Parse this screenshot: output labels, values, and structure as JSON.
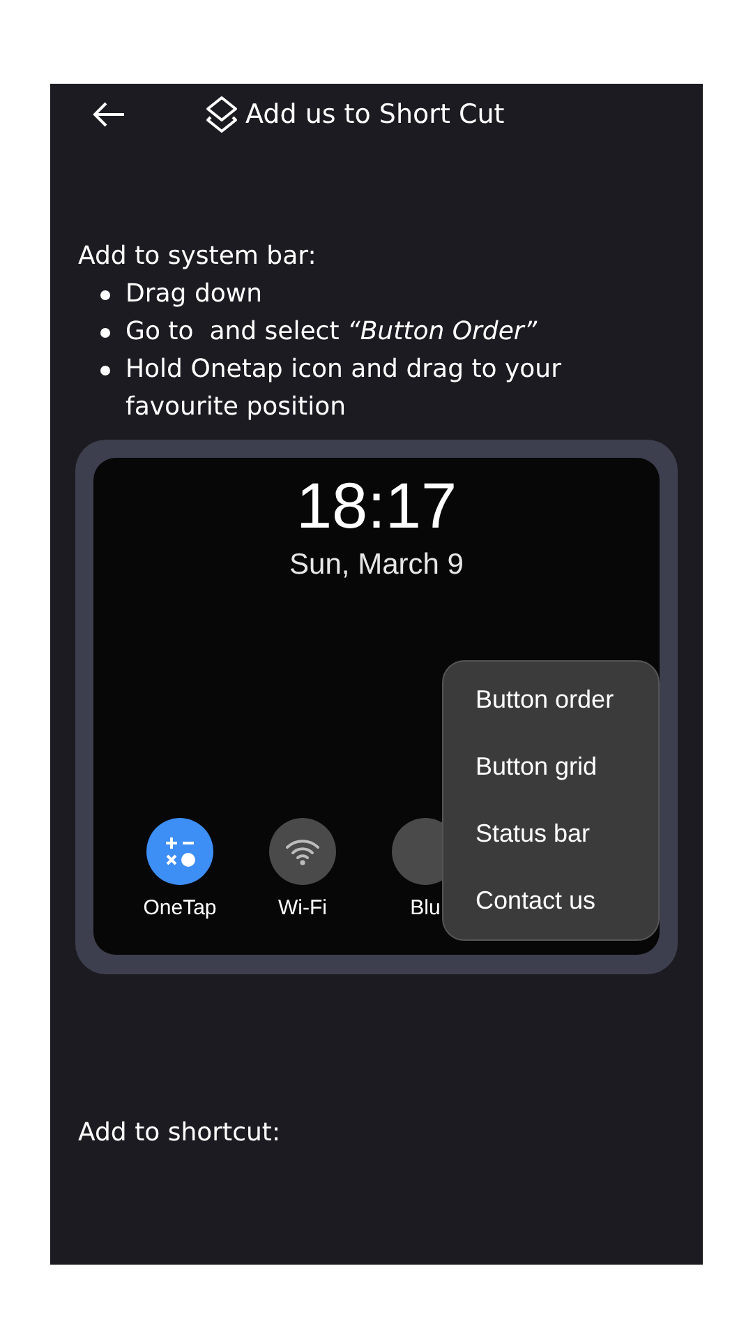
{
  "header": {
    "title": "Add us to Short Cut"
  },
  "system_bar_section": {
    "heading": "Add to system bar:",
    "steps": [
      "Drag down",
      "Go to  and select *“Button Order”*",
      "Hold Onetap icon and drag to your favourite position"
    ]
  },
  "phone_preview": {
    "time": "18:17",
    "date": "Sun, March 9",
    "tiles": [
      {
        "label": "OneTap",
        "kind": "calculator",
        "on": true
      },
      {
        "label": "Wi-Fi",
        "kind": "wifi",
        "on": false
      },
      {
        "label": "Blu",
        "kind": "blank",
        "on": false
      }
    ],
    "menu": [
      "Button order",
      "Button grid",
      "Status bar",
      "Contact us"
    ]
  },
  "shortcut_section": {
    "heading": "Add to shortcut:"
  }
}
